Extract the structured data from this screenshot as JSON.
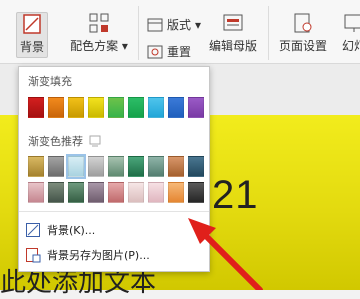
{
  "ribbon": {
    "background_label": "背景",
    "color_scheme_label": "配色方案",
    "layout_label": "版式",
    "reset_label": "重置",
    "edit_master_label": "编辑母版",
    "page_setup_label": "页面设置",
    "slideshow_label": "幻灯"
  },
  "dropdown": {
    "gradient_fill_title": "渐变填充",
    "gradient_recommend_title": "渐变色推荐",
    "background_item": "背景(K)...",
    "save_background_item": "背景另存为图片(P)..."
  },
  "slide": {
    "number_text": "21",
    "body_text": "此处添加文本"
  },
  "colors": {
    "arrow": "#e0201b",
    "slide_yellow": "#e6dd12",
    "gradient_fill_row": [
      "#d31f1f",
      "#f28a1c",
      "#f2c018",
      "#f2e21e",
      "#37b34a",
      "#15a24b",
      "#21a6d8",
      "#1f5fbd",
      "#7a3aa5"
    ],
    "recommend_row1": [
      "#c9a54a",
      "#8c8c8c",
      "#bfe0ea",
      "#bcbcbc",
      "#7fa58e",
      "#2f8a5c",
      "#6b9a8b",
      "#c07a4a",
      "#2f5a70"
    ],
    "recommend_row2": [
      "#d6a2a9",
      "#5f6f5f",
      "#4f7a5e",
      "#8e7a8c",
      "#d4898a",
      "#e9d2d2",
      "#efd0d6",
      "#f0a05a",
      "#3a3a3a"
    ]
  }
}
